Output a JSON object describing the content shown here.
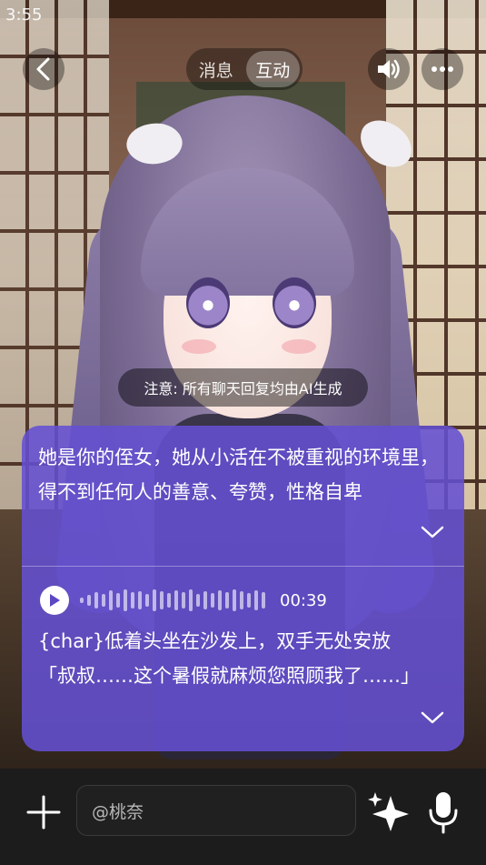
{
  "status_bar": {
    "time": "3:55"
  },
  "header": {
    "tabs": [
      {
        "label": "消息",
        "active": false
      },
      {
        "label": "互动",
        "active": true
      }
    ],
    "back_icon": "chevron-left-icon",
    "sound_icon": "speaker-icon",
    "more_icon": "more-dots-icon"
  },
  "notice": {
    "text": "注意: 所有聊天回复均由AI生成"
  },
  "chat": {
    "intro": "她是你的侄女，她从小活在不被重视的环境里，得不到任何人的善意、夸赞，性格自卑",
    "audio": {
      "duration": "00:39"
    },
    "message_line1": "{char}低着头坐在沙发上，双手无处安放",
    "message_line2": "「叔叔……这个暑假就麻烦您照顾我了……」",
    "panel_color": "#6450d2"
  },
  "bottom_bar": {
    "input_value": "@桃奈",
    "plus_icon": "plus-icon",
    "sparkle_icon": "sparkle-icon",
    "mic_icon": "microphone-icon"
  }
}
